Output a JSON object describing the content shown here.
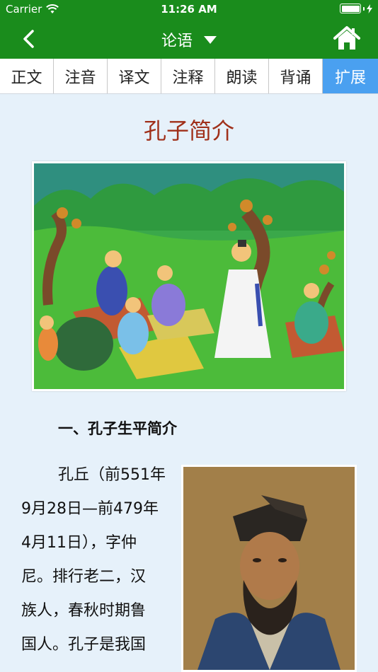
{
  "status_bar": {
    "carrier": "Carrier",
    "time": "11:26 AM",
    "battery_level": 1.0
  },
  "nav": {
    "title": "论语"
  },
  "tabs": [
    {
      "label": "正文"
    },
    {
      "label": "注音"
    },
    {
      "label": "译文"
    },
    {
      "label": "注释"
    },
    {
      "label": "朗读"
    },
    {
      "label": "背诵"
    },
    {
      "label": "扩展"
    }
  ],
  "active_tab": "扩展",
  "article": {
    "title": "孔子简介",
    "section_heading": "一、孔子生平简介",
    "body_lines": [
      "孔丘（前551年",
      "9月28日—前479年",
      "4月11日），字仲",
      "尼。排行老二，汉",
      "族人，春秋时期鲁",
      "国人。孔子是我国"
    ]
  },
  "colors": {
    "header_green": "#1a8c1c",
    "active_tab": "#4aa0f0",
    "title_red": "#a0301a",
    "background": "#e6f1fa"
  }
}
